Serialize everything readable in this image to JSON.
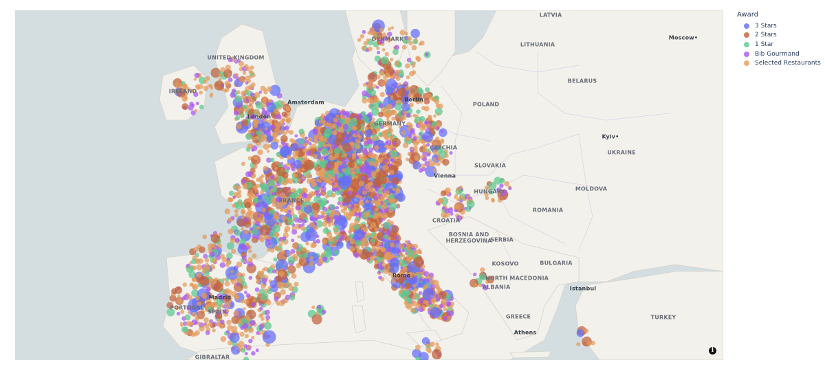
{
  "legend": {
    "title": "Award",
    "items": [
      {
        "label": "3 Stars",
        "color": "#636efa"
      },
      {
        "label": "2 Stars",
        "color": "#c0613a"
      },
      {
        "label": "1 Star",
        "color": "#5cc88f"
      },
      {
        "label": "Bib Gourmand",
        "color": "#a657f0"
      },
      {
        "label": "Selected Restaurants",
        "color": "#e39a5c"
      }
    ]
  },
  "map": {
    "info_glyph": "i",
    "country_labels": [
      "LATVIA",
      "DENMARK",
      "LITHUANIA",
      "UNITED KINGDOM",
      "IRELAND",
      "BELARUS",
      "POLAND",
      "GERMANY",
      "CZECHIA",
      "UKRAINE",
      "SLOVAKIA",
      "MOLDOVA",
      "HUNGARY",
      "FRANCE",
      "ROMANIA",
      "CROATIA",
      "BOSNIA AND HERZEGOVINA",
      "SERBIA",
      "KOSOVO",
      "BULGARIA",
      "NORTH MACEDONIA",
      "ALBANIA",
      "PORTUGAL",
      "SPAIN",
      "GREECE",
      "TURKEY",
      "GIBRALTAR"
    ],
    "city_labels": [
      "Moscow",
      "Amsterdam",
      "Kyiv",
      "Vienna",
      "Istanbul",
      "Madrid",
      "Rome",
      "Athens",
      "London",
      "Berlin"
    ]
  }
}
